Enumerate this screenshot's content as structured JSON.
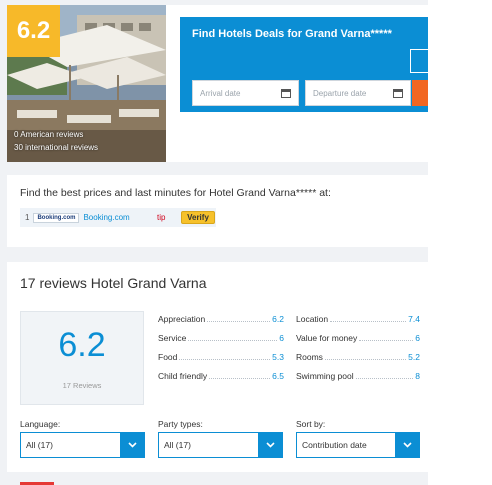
{
  "hero": {
    "score": "6.2",
    "american_reviews": "0 American reviews",
    "international_reviews": "30 international reviews"
  },
  "deals": {
    "title": "Find Hotels Deals for Grand Varna*****",
    "arrival_placeholder": "Arrival date",
    "departure_placeholder": "Departure date",
    "accent_color": "#0b8ed4",
    "button_color": "#f26722"
  },
  "prices": {
    "title": "Find the best prices and last minutes for Hotel Grand Varna***** at:",
    "row": {
      "rank": "1",
      "logo_text": "Booking.com",
      "link_text": "Booking.com",
      "tip": "tip",
      "verify_label": "Verify"
    }
  },
  "reviews": {
    "title": "17 reviews Hotel Grand Varna",
    "overall_score": "6.2",
    "count_label": "17 Reviews",
    "ratings": [
      {
        "label": "Appreciation",
        "value": "6.2"
      },
      {
        "label": "Service",
        "value": "6"
      },
      {
        "label": "Food",
        "value": "5.3"
      },
      {
        "label": "Child friendly",
        "value": "6.5"
      },
      {
        "label": "Location",
        "value": "7.4"
      },
      {
        "label": "Value for money",
        "value": "6"
      },
      {
        "label": "Rooms",
        "value": "5.2"
      },
      {
        "label": "Swimming pool",
        "value": "8"
      }
    ],
    "filters": {
      "language_label": "Language:",
      "language_value": "All (17)",
      "party_label": "Party types:",
      "party_value": "All (17)",
      "sort_label": "Sort by:",
      "sort_value": "Contribution date"
    }
  },
  "icons": {
    "calendar": "calendar-icon",
    "dropdown": "chevron-down-icon"
  }
}
